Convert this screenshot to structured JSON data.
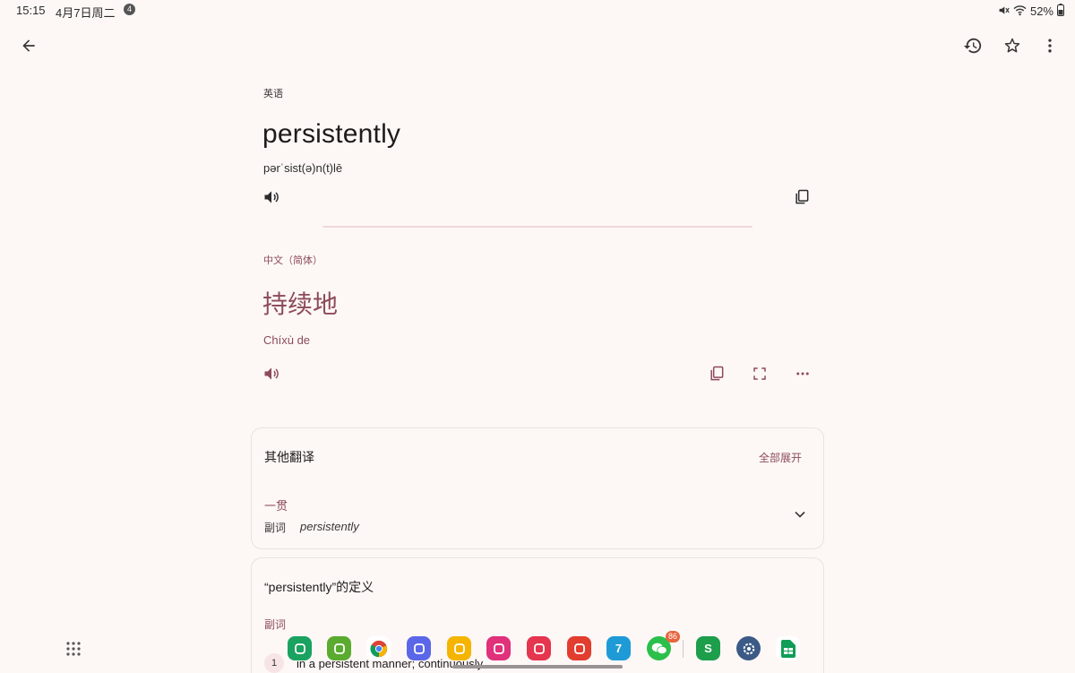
{
  "status_bar": {
    "time": "15:15",
    "date": "4月7日周二",
    "notification_count": "4",
    "battery": "52%"
  },
  "source": {
    "language": "英语",
    "word": "persistently",
    "pronunciation": "pərˈsist(ə)n(t)lē"
  },
  "target": {
    "language": "中文（简体）",
    "word": "持续地",
    "transliteration": "Chíxù de"
  },
  "other_translations": {
    "title": "其他翻译",
    "expand_all": "全部展开",
    "items": [
      {
        "word": "一贯",
        "pos": "副词",
        "synonym": "persistently"
      }
    ]
  },
  "definitions": {
    "title": "“persistently”的定义",
    "pos": "副词",
    "items": [
      {
        "num": "1",
        "text": "in a persistent manner; continuously."
      }
    ]
  },
  "dock": {
    "apps": [
      {
        "name": "phone-app",
        "color": "#1aa260"
      },
      {
        "name": "calculator-app",
        "color": "#5aab2f"
      },
      {
        "name": "chrome-app",
        "color": "#ffffff"
      },
      {
        "name": "reminder-app",
        "color": "#5b67e8"
      },
      {
        "name": "files-app",
        "color": "#f5b400"
      },
      {
        "name": "bixby-app",
        "color": "#e0317a"
      },
      {
        "name": "camera-app",
        "color": "#e5354f"
      },
      {
        "name": "notes-app",
        "color": "#e23d2f"
      },
      {
        "name": "calendar-app",
        "color": "#1e9bd7",
        "label": "7"
      },
      {
        "name": "wechat-app",
        "color": "#2bbf4b",
        "badge": "86"
      },
      {
        "name": "s-app",
        "color": "#1d9e4a",
        "label": "S"
      },
      {
        "name": "settings-app",
        "color": "#3b5a86"
      },
      {
        "name": "sheets-app",
        "color": "#ffffff"
      }
    ]
  }
}
